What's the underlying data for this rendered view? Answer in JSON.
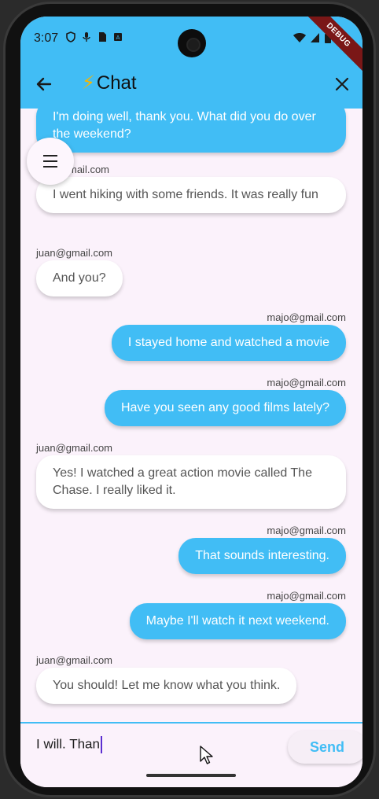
{
  "status_bar": {
    "time": "3:07",
    "debug_banner": "DEBUG"
  },
  "app_bar": {
    "title": "Chat",
    "title_icon": "lightning-icon",
    "accent_color": "#41bdf5"
  },
  "messages": [
    {
      "sender": "",
      "text": "I'm doing well, thank you. What did you do over the weekend?",
      "direction": "out"
    },
    {
      "sender": "juan@gmail.com",
      "sender_visible": "mail.com",
      "text": "I went hiking with some friends. It was really fun",
      "direction": "in"
    },
    {
      "sender": "juan@gmail.com",
      "text": "And you?",
      "direction": "in"
    },
    {
      "sender": "majo@gmail.com",
      "text": "I stayed home and watched a movie",
      "direction": "out"
    },
    {
      "sender": "majo@gmail.com",
      "text": "Have you seen any good films lately?",
      "direction": "out"
    },
    {
      "sender": "juan@gmail.com",
      "text": "Yes! I watched a great action movie called The Chase. I really liked it.",
      "direction": "in"
    },
    {
      "sender": "majo@gmail.com",
      "text": "That sounds interesting.",
      "direction": "out"
    },
    {
      "sender": "majo@gmail.com",
      "text": "Maybe I'll watch it next weekend.",
      "direction": "out"
    },
    {
      "sender": "juan@gmail.com",
      "text": "You should! Let me know what you think.",
      "direction": "in"
    }
  ],
  "composer": {
    "value": "I will. Than",
    "send_label": "Send"
  }
}
